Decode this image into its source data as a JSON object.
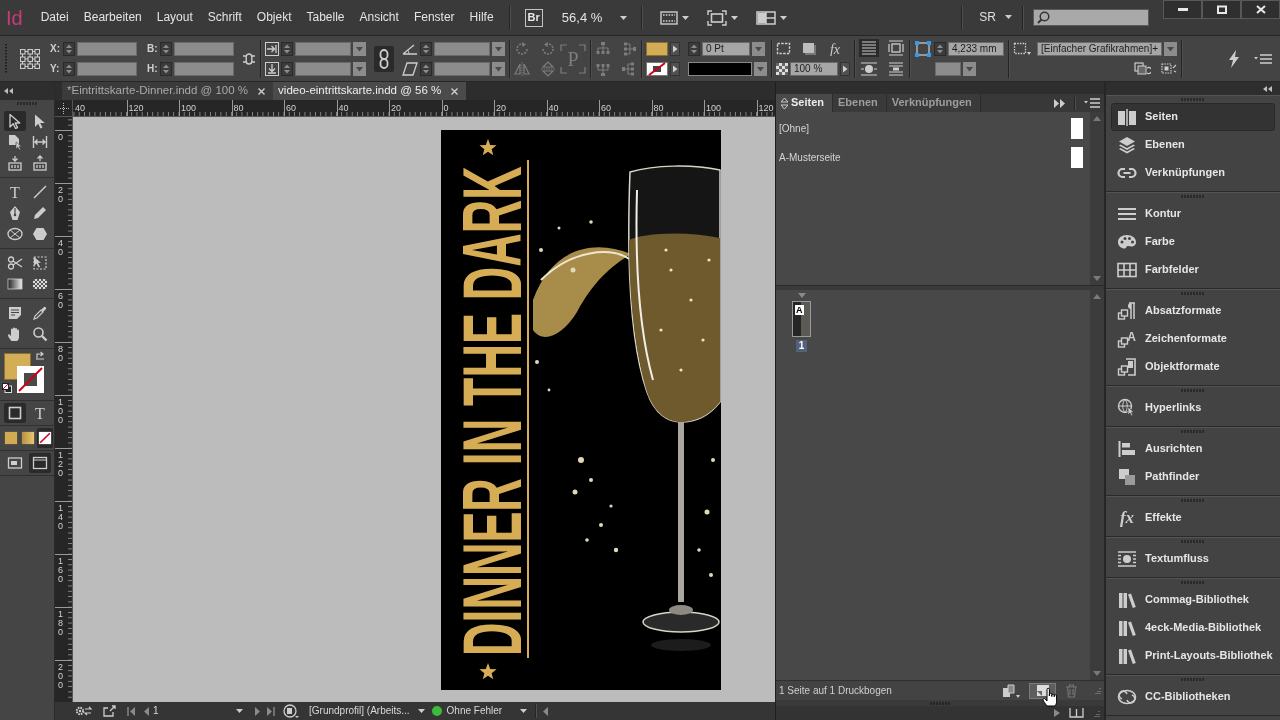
{
  "app": {
    "logo": "Id",
    "menus": [
      "Datei",
      "Bearbeiten",
      "Layout",
      "Schrift",
      "Objekt",
      "Tabelle",
      "Ansicht",
      "Fenster",
      "Hilfe"
    ],
    "bridge": "Br",
    "zoom": "56,4 %",
    "workspace": "SR"
  },
  "control_bar": {
    "position_labels": [
      "X:",
      "Y:"
    ],
    "size_labels": [
      "B:",
      "H:"
    ],
    "frame_glyph": "P",
    "stroke_weight": "0 Pt",
    "effects_glyph": "fx",
    "opacity": "100 %",
    "fitting_size": "4,233 mm",
    "object_style": "[Einfacher Grafikrahmen]+"
  },
  "document_tabs": [
    {
      "title": "*Eintrittskarte-Dinner.indd @ 100 %",
      "selected": false
    },
    {
      "title": "video-eintrittskarte.indd @ 56 %",
      "selected": true
    }
  ],
  "tools": [
    [
      {
        "kind": "select",
        "selected": true
      },
      {
        "kind": "direct",
        "selected": false
      },
      {
        "kind": "page",
        "selected": false
      },
      {
        "kind": "gap",
        "selected": false
      },
      {
        "kind": "collector",
        "selected": false
      },
      {
        "kind": "placer",
        "selected": false
      }
    ],
    [
      {
        "kind": "type",
        "glyph": "T",
        "selected": false
      },
      {
        "kind": "line",
        "selected": false
      },
      {
        "kind": "pen",
        "selected": false
      },
      {
        "kind": "pencil",
        "selected": false
      },
      {
        "kind": "ellipseframe",
        "selected": false
      },
      {
        "kind": "polygon",
        "selected": false
      }
    ],
    [
      {
        "kind": "scissors",
        "selected": false
      },
      {
        "kind": "transform",
        "selected": false
      },
      {
        "kind": "gradient",
        "selected": false
      },
      {
        "kind": "feather",
        "selected": false
      }
    ],
    [
      {
        "kind": "note",
        "selected": false
      },
      {
        "kind": "eyedropper",
        "selected": false
      },
      {
        "kind": "hand",
        "selected": false
      },
      {
        "kind": "zoom",
        "selected": false
      }
    ]
  ],
  "formatting": [
    {
      "kind": "container",
      "selected": true
    },
    {
      "kind": "text",
      "glyph": "T",
      "selected": false
    }
  ],
  "apply": [
    {
      "kind": "applycolor",
      "selected": false
    },
    {
      "kind": "applygradient",
      "selected": false
    },
    {
      "kind": "applynone",
      "selected": true
    }
  ],
  "view_modes": [
    {
      "kind": "screen",
      "selected": false
    },
    {
      "kind": "mode",
      "selected": true
    }
  ],
  "rulers": {
    "horizontal": [
      "40",
      "120",
      "100",
      "80",
      "60",
      "40",
      "20",
      "0",
      "20",
      "40",
      "60",
      "80",
      "100",
      "120"
    ],
    "vertical": [
      "0",
      "20",
      "40",
      "60",
      "80",
      "100",
      "120",
      "140",
      "160",
      "180",
      "200"
    ]
  },
  "page": {
    "title": "DINNER IN THE DARK"
  },
  "status_bar": {
    "page": "1",
    "profile": "[Grundprofil] (Arbeits...",
    "preflight": "Ohne Fehler",
    "preflight_errors": false
  },
  "pages_panel": {
    "tabs": [
      {
        "label": "Seiten",
        "selected": true
      },
      {
        "label": "Ebenen",
        "selected": false
      },
      {
        "label": "Verknüpfungen",
        "selected": false
      }
    ],
    "masters": [
      "[Ohne]",
      "A-Musterseite"
    ],
    "pages": [
      {
        "master": "A",
        "number": "1",
        "selected": true
      }
    ],
    "summary": "1 Seite auf 1 Druckbogen"
  },
  "dock": [
    [
      {
        "kind": "pages",
        "label": "Seiten",
        "selected": true
      },
      {
        "kind": "layers",
        "label": "Ebenen",
        "selected": false
      },
      {
        "kind": "links",
        "label": "Verknüpfungen",
        "selected": false
      }
    ],
    [
      {
        "kind": "stroke",
        "label": "Kontur",
        "selected": false
      },
      {
        "kind": "color",
        "label": "Farbe",
        "selected": false
      },
      {
        "kind": "swatches",
        "label": "Farbfelder",
        "selected": false
      }
    ],
    [
      {
        "kind": "parastyles",
        "label": "Absatzformate",
        "selected": false
      },
      {
        "kind": "charstyles",
        "glyph": "A",
        "label": "Zeichenformate",
        "selected": false
      },
      {
        "kind": "objstyles",
        "label": "Objektformate",
        "selected": false
      }
    ],
    [
      {
        "kind": "hyperlinks",
        "label": "Hyperlinks",
        "selected": false
      }
    ],
    [
      {
        "kind": "align",
        "label": "Ausrichten",
        "selected": false
      },
      {
        "kind": "pathfinder",
        "label": "Pathfinder",
        "selected": false
      }
    ],
    [
      {
        "kind": "effects",
        "glyph": "fx",
        "label": "Effekte",
        "selected": false
      }
    ],
    [
      {
        "kind": "textwrap",
        "label": "Textumfluss",
        "selected": false
      }
    ],
    [
      {
        "kind": "library",
        "label": "Commag-Bibliothek",
        "selected": false
      },
      {
        "kind": "library",
        "label": "4eck-Media-Bibliothek",
        "selected": false
      },
      {
        "kind": "library",
        "label": "Print-Layouts-Bibliothek",
        "selected": false
      }
    ],
    [
      {
        "kind": "cclibraries",
        "label": "CC-Bibliotheken",
        "selected": false
      }
    ]
  ]
}
